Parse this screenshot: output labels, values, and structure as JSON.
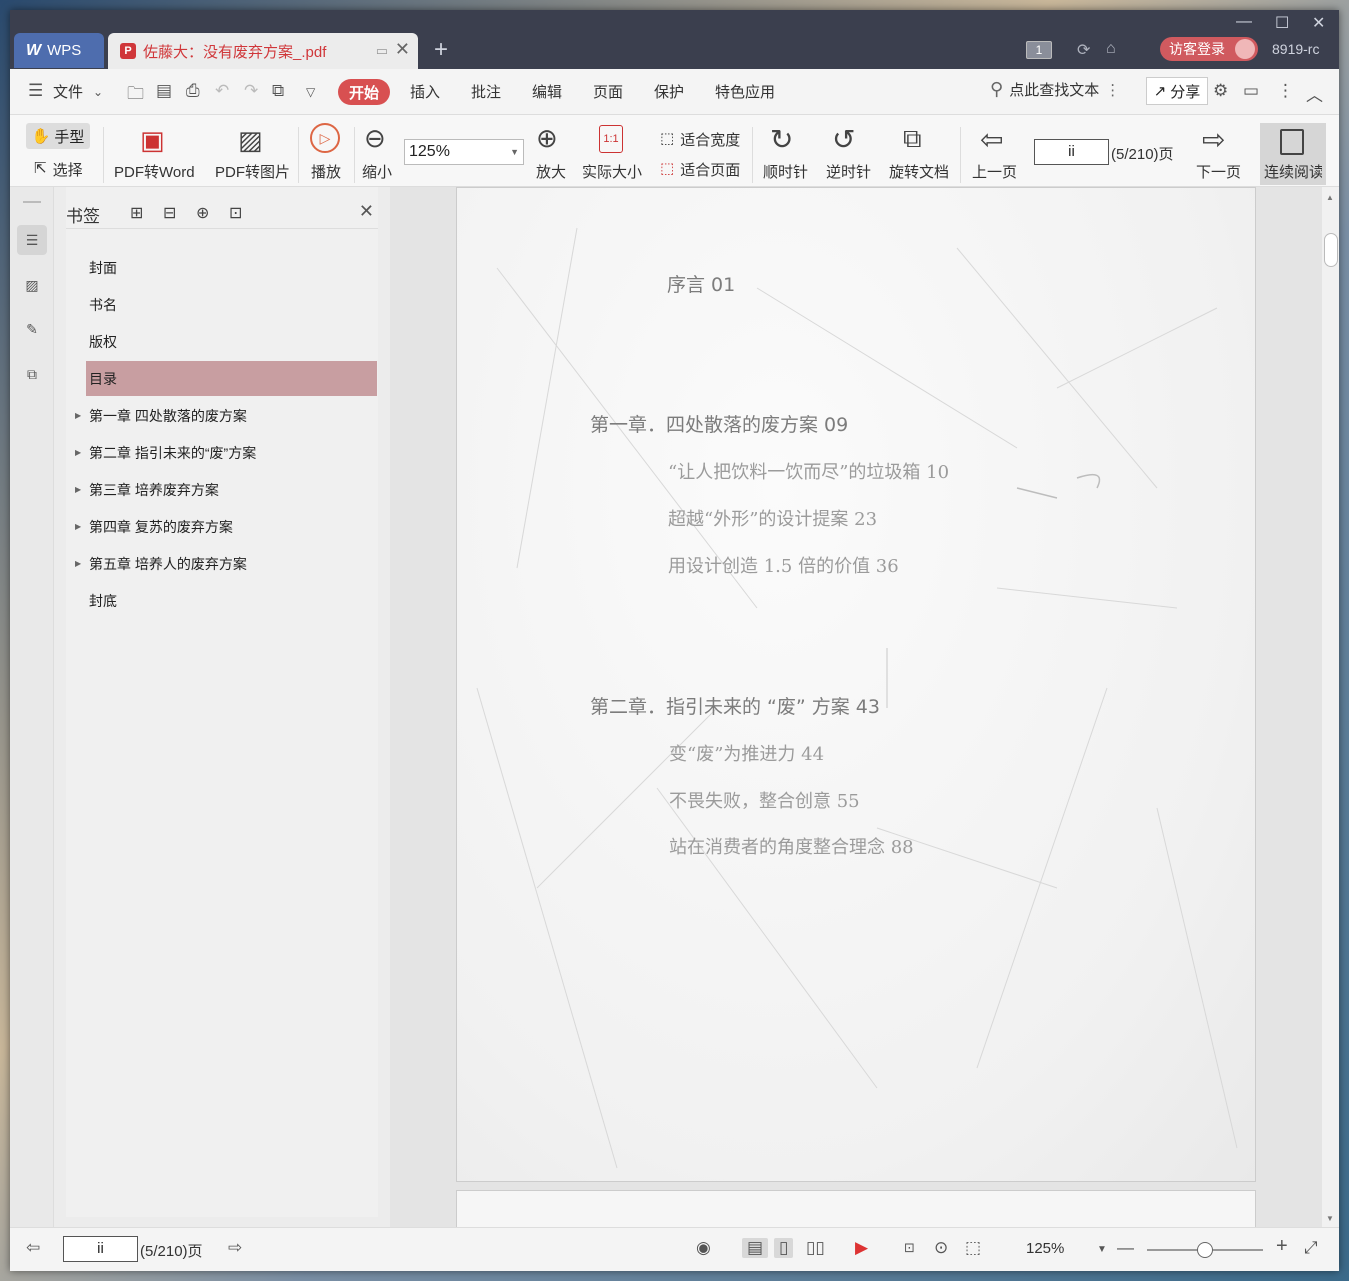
{
  "titlebar": {
    "wps_tab": "WPS",
    "doc_tab": "佐藤大：没有废弃方案_.pdf",
    "window_count": "1",
    "login": "访客登录",
    "user_id": "8919-rc"
  },
  "menubar": {
    "file": "文件",
    "tabs": [
      "开始",
      "插入",
      "批注",
      "编辑",
      "页面",
      "保护",
      "特色应用"
    ],
    "search": "点此查找文本",
    "share": "分享"
  },
  "toolbar": {
    "hand": "手型",
    "select": "选择",
    "pdf_to_word": "PDF转Word",
    "pdf_to_image": "PDF转图片",
    "play": "播放",
    "zoom_out": "缩小",
    "zoom_value": "125%",
    "zoom_in": "放大",
    "actual_size": "实际大小",
    "fit_width": "适合宽度",
    "fit_page": "适合页面",
    "clockwise": "顺时针",
    "counterclockwise": "逆时针",
    "rotate_doc": "旋转文档",
    "prev_page": "上一页",
    "page_input": "ii",
    "page_count": "(5/210)页",
    "next_page": "下一页",
    "continuous_read": "连续阅读"
  },
  "bookmarks": {
    "title": "书签",
    "items": [
      {
        "label": "封面",
        "expandable": false,
        "selected": false
      },
      {
        "label": "书名",
        "expandable": false,
        "selected": false
      },
      {
        "label": "版权",
        "expandable": false,
        "selected": false
      },
      {
        "label": "目录",
        "expandable": false,
        "selected": true
      },
      {
        "label": "第一章  四处散落的废方案",
        "expandable": true,
        "selected": false
      },
      {
        "label": "第二章  指引未来的“废”方案",
        "expandable": true,
        "selected": false
      },
      {
        "label": "第三章  培养废弃方案",
        "expandable": true,
        "selected": false
      },
      {
        "label": "第四章  复苏的废弃方案",
        "expandable": true,
        "selected": false
      },
      {
        "label": "第五章  培养人的废弃方案",
        "expandable": true,
        "selected": false
      },
      {
        "label": "封底",
        "expandable": false,
        "selected": false
      }
    ]
  },
  "page_content": {
    "preface": "序言 01",
    "chapter1": "第一章．四处散落的废方案 09",
    "c1_items": [
      "“让人把饮料一饮而尽”的垃圾箱 10",
      "超越“外形”的设计提案 23",
      "用设计创造 1.5 倍的价值 36"
    ],
    "chapter2": "第二章．指引未来的 “废” 方案 43",
    "c2_items": [
      "变“废”为推进力 44",
      "不畏失败，整合创意 55",
      "站在消费者的角度整合理念 88"
    ]
  },
  "statusbar": {
    "page_input": "ii",
    "page_count": "(5/210)页",
    "zoom": "125%",
    "zoom_level": 0.5
  },
  "colors": {
    "titlebar": "#3b3f4e",
    "accent_red": "#d85051",
    "selected_bookmark": "#c89ea1",
    "wps_tab": "#4e6dae"
  }
}
